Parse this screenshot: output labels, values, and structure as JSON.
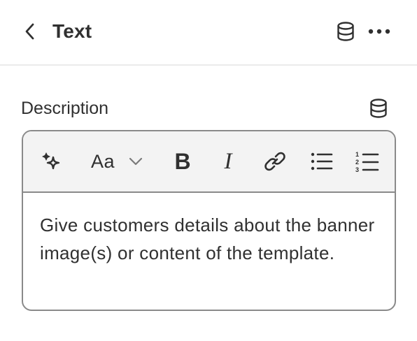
{
  "header": {
    "title": "Text",
    "back_icon": "chevron-left-icon",
    "dynamic_source_icon": "database-icon",
    "more_icon": "more-horizontal-icon"
  },
  "field": {
    "label": "Description",
    "dynamic_source_icon": "database-icon"
  },
  "toolbar": {
    "ai_icon": "magic-sparkle-icon",
    "text_style_label": "Aa",
    "text_style_dropdown_icon": "chevron-down-icon",
    "bold_label": "B",
    "italic_label": "I",
    "link_icon": "link-icon",
    "bullet_list_icon": "bullet-list-icon",
    "numbered_list_icon": "numbered-list-icon"
  },
  "editor": {
    "content": "Give customers details about the banner image(s) or content of the template."
  },
  "colors": {
    "text": "#303030",
    "border": "#8a8a8a",
    "toolbar_bg": "#f3f3f3",
    "divider": "#ebebeb"
  }
}
